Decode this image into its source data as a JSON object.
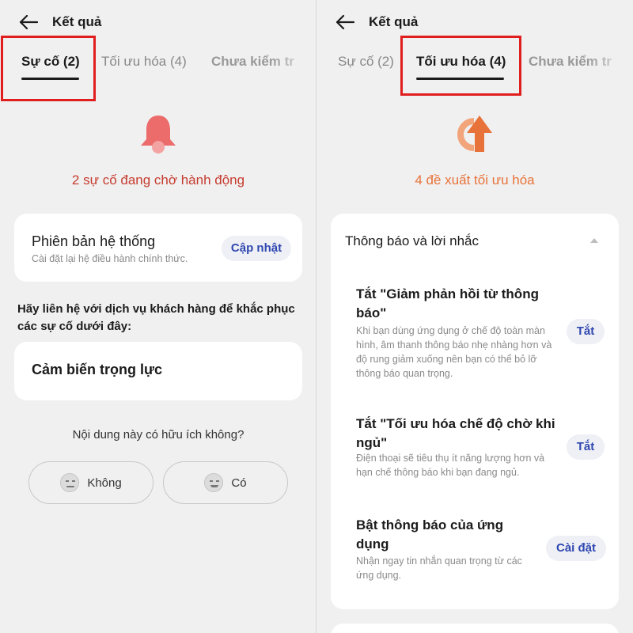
{
  "header": {
    "title": "Kết quả"
  },
  "tabs": {
    "issues": "Sự cố (2)",
    "optimize": "Tối ưu hóa (4)",
    "unchecked": "Chưa kiểm tr"
  },
  "left": {
    "summary": "2 sự cố đang chờ hành động",
    "system_card": {
      "title": "Phiên bản hệ thống",
      "subtitle": "Cài đặt lại hệ điều hành chính thức.",
      "button": "Cập nhật"
    },
    "contact_text": "Hãy liên hệ với dịch vụ khách hàng để khắc phục các sự cố dưới đây:",
    "sensor_card": {
      "title": "Cảm biến trọng lực"
    },
    "question": "Nội dung này có hữu ích không?",
    "no_label": "Không",
    "yes_label": "Có"
  },
  "right": {
    "summary": "4 đề xuất tối ưu hóa",
    "section_title": "Thông báo và lời nhắc",
    "items": [
      {
        "title": "Tắt \"Giảm phản hồi từ thông báo\"",
        "desc": "Khi bạn dùng ứng dụng ở chế độ toàn màn hình, âm thanh thông báo nhẹ nhàng hơn và độ rung giảm xuống nên bạn có thể bỏ lỡ thông báo quan trọng.",
        "button": "Tắt"
      },
      {
        "title": "Tắt \"Tối ưu hóa chế độ chờ khi ngủ\"",
        "desc": "Điện thoại sẽ tiêu thụ ít năng lượng hơn và hạn chế thông báo khi bạn đang ngủ.",
        "button": "Tắt"
      },
      {
        "title": "Bật thông báo của ứng dụng",
        "desc": "Nhận ngay tin nhắn quan trọng từ các ứng dụng.",
        "button": "Cài đặt"
      }
    ]
  },
  "colors": {
    "issue_red": "#c63b2e",
    "bell": "#ec6b6b",
    "optimize_orange": "#e8733a",
    "highlight_box": "#e01e1e",
    "pill_text": "#2f47b0"
  },
  "icons": [
    "back-arrow-icon",
    "bell-icon",
    "optimize-arrow-icon",
    "caret-up-icon",
    "neutral-face-icon",
    "smile-face-icon"
  ]
}
